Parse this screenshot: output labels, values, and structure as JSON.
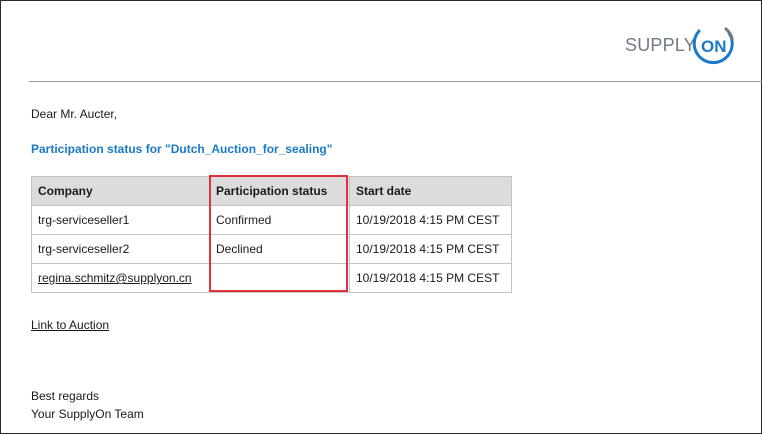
{
  "brand": {
    "logo_text": "SUPPLY",
    "logo_accent": "ON",
    "logo_color": "#6f7a85",
    "accent_color": "#1a7ac8"
  },
  "greeting": "Dear Mr. Aucter,",
  "heading": "Participation status for \"Dutch_Auction_for_sealing\"",
  "table": {
    "headers": [
      "Company",
      "Participation status",
      "Start date"
    ],
    "rows": [
      [
        "trg-serviceseller1",
        "Confirmed",
        "10/19/2018 4:15 PM CEST"
      ],
      [
        "trg-serviceseller2",
        "Declined",
        "10/19/2018 4:15 PM CEST"
      ],
      [
        "regina.schmitz@supplyon.cn",
        "",
        "10/19/2018 4:15 PM CEST"
      ]
    ]
  },
  "highlight_color": "#e0323a",
  "auction_link": "Link to Auction",
  "closing": {
    "regards": "Best regards",
    "signature": "Your SupplyOn Team"
  }
}
